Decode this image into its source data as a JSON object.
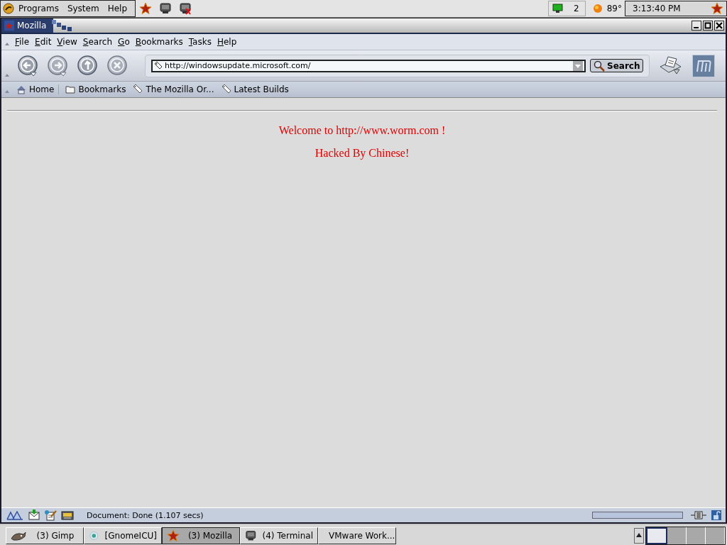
{
  "top_panel": {
    "menus": [
      "Programs",
      "System",
      "Help"
    ],
    "workspace_number": "2",
    "temperature": "89°",
    "clock": "3:13:40 PM"
  },
  "window": {
    "title": "Mozilla"
  },
  "menu_bar": [
    "File",
    "Edit",
    "View",
    "Search",
    "Go",
    "Bookmarks",
    "Tasks",
    "Help"
  ],
  "navigation_toolbar": {
    "url": "http://windowsupdate.microsoft.com/",
    "search_button": "Search"
  },
  "personal_toolbar": [
    {
      "kind": "home",
      "label": "Home"
    },
    {
      "kind": "folder",
      "label": "Bookmarks"
    },
    {
      "kind": "link",
      "label": "The Mozilla Or..."
    },
    {
      "kind": "link",
      "label": "Latest Builds"
    }
  ],
  "content": {
    "lines": [
      "Welcome to http://www.worm.com !",
      "Hacked By Chinese!"
    ]
  },
  "status_bar": {
    "text": "Document: Done (1.107 secs)"
  },
  "taskbar": {
    "tasks": [
      {
        "kind": "gimp",
        "label": "(3) Gimp",
        "selected": false
      },
      {
        "kind": "globe",
        "label": "[GnomeICU]",
        "selected": false
      },
      {
        "kind": "star",
        "label": "(3) Mozilla",
        "selected": true
      },
      {
        "kind": "terminal",
        "label": "(4) Terminal",
        "selected": false
      },
      {
        "kind": "vmware",
        "label": "VMware Work...",
        "selected": false
      }
    ],
    "workspaces": [
      {
        "selected": true
      },
      {
        "selected": false
      },
      {
        "selected": false
      },
      {
        "selected": false
      }
    ]
  }
}
